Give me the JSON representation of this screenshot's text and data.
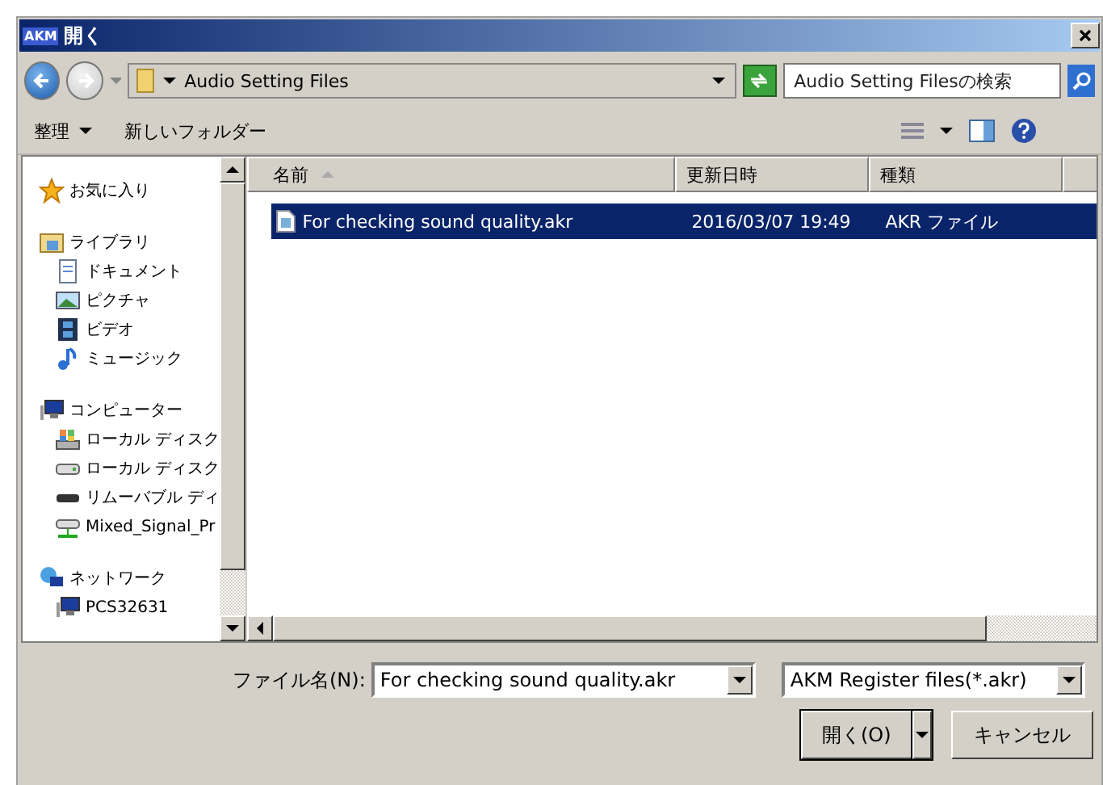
{
  "window": {
    "title": "開く",
    "app_badge": "AKM"
  },
  "address_bar": {
    "path": "Audio Setting Files",
    "search_placeholder": "Audio Setting Filesの検索"
  },
  "toolbar": {
    "organize": "整理",
    "new_folder": "新しいフォルダー"
  },
  "sidebar": {
    "items": [
      {
        "label": "お気に入り"
      },
      {
        "label": "ライブラリ",
        "children": [
          {
            "label": "ドキュメント"
          },
          {
            "label": "ピクチャ"
          },
          {
            "label": "ビデオ"
          },
          {
            "label": "ミュージック"
          }
        ]
      },
      {
        "label": "コンピューター",
        "children": [
          {
            "label": "ローカル ディスク"
          },
          {
            "label": "ローカル ディスク"
          },
          {
            "label": "リムーバブル ディ"
          },
          {
            "label": "Mixed_Signal_Pr"
          }
        ]
      },
      {
        "label": "ネットワーク",
        "children": [
          {
            "label": "PCS32631"
          }
        ]
      }
    ]
  },
  "table": {
    "columns": [
      {
        "label": "名前",
        "sorted": true
      },
      {
        "label": "更新日時",
        "sorted": false
      },
      {
        "label": "種類",
        "sorted": false
      }
    ],
    "rows": [
      {
        "cells": [
          "For checking sound quality.akr",
          "2016/03/07 19:49",
          "AKR ファイル"
        ],
        "selected": true
      }
    ]
  },
  "footer": {
    "filename_label": "ファイル名(N):",
    "filename": "For checking sound quality.akr",
    "filter": "AKM Register files(*.akr)",
    "open_button": "開く(O)",
    "cancel_button": "キャンセル"
  }
}
